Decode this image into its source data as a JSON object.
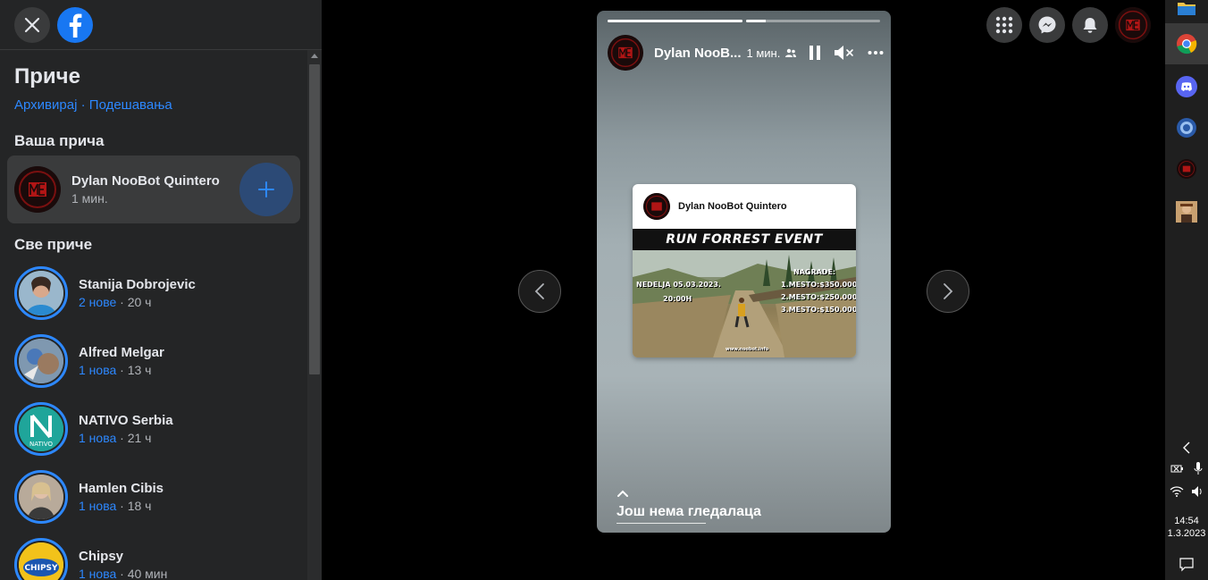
{
  "sidebar": {
    "title": "Приче",
    "links": {
      "archive": "Архивирај",
      "separator": "·",
      "settings": "Подешавања"
    },
    "your_story_heading": "Ваша прича",
    "your_story": {
      "name": "Dylan NooBot Quintero",
      "time": "1 мин."
    },
    "all_stories_heading": "Све приче",
    "stories": [
      {
        "name": "Stanija Dobrojevic",
        "new": "2 нове",
        "time": "· 20 ч",
        "avatar_color": "#5a8fb0"
      },
      {
        "name": "Alfred Melgar",
        "new": "1 нова",
        "time": "· 13 ч",
        "avatar_color": "#6f8fb0"
      },
      {
        "name": "NATIVO Serbia",
        "new": "1 нова",
        "time": "· 21 ч",
        "avatar_color": "#1fa59a"
      },
      {
        "name": "Hamlen Cibis",
        "new": "1 нова",
        "time": "· 18 ч",
        "avatar_color": "#8c7a6a"
      },
      {
        "name": "Chipsy",
        "new": "1 нова",
        "time": "· 40 мин",
        "avatar_color": "#f2c21a"
      }
    ],
    "nativo_logo_text": "NATIVO",
    "chipsy_logo_text": "CHIPSY"
  },
  "story": {
    "user": "Dylan NooB...",
    "time": "1 мин.",
    "progress": [
      1.0,
      0.15
    ],
    "post": {
      "author": "Dylan NooBot Quintero",
      "banner": "RUN FORREST EVENT",
      "date": "NEDELJA 05.03.2023.",
      "hour": "20:00H",
      "prizes_title": "NAGRADE:",
      "prize1": "1.MESTO:$350.000",
      "prize2": "2.MESTO:$250.000",
      "prize3": "3.MESTO:$150.000",
      "site": "www.noobot.info"
    },
    "footer": "Још нема гледалаца"
  },
  "taskbar": {
    "time": "14:54",
    "date": "1.3.2023"
  },
  "colors": {
    "accent": "#2d88ff",
    "sidebar_bg": "#242526",
    "facebook_blue": "#1877f2"
  }
}
